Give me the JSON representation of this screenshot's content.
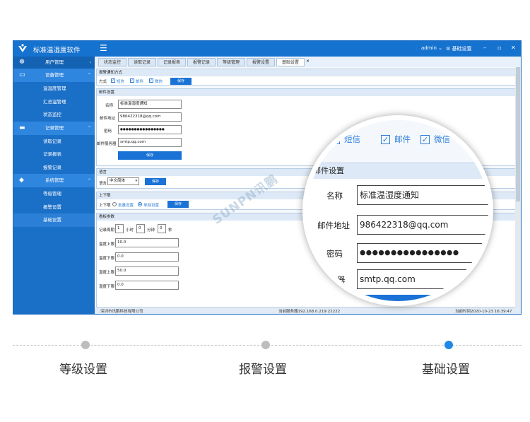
{
  "app": {
    "title": "标准温湿度软件",
    "menu_icon": "☰",
    "user": "admin",
    "settings": "基础设置",
    "win_min": "–",
    "win_max": "▫",
    "win_close": "✕"
  },
  "sidebar": {
    "user_mgmt": "用户管理",
    "groups": [
      {
        "label": "设备管理",
        "icon": "monitor-icon",
        "items": [
          "温湿度管理",
          "汇总温管理",
          "状态监控"
        ]
      },
      {
        "label": "记录管理",
        "icon": "folder-icon",
        "items": [
          "读取记录",
          "记录报表",
          "报警记录"
        ]
      },
      {
        "label": "系统管理",
        "icon": "cube-icon",
        "items": [
          "等级管理",
          "报警设置",
          "基础设置"
        ]
      }
    ]
  },
  "tabs": [
    "状态监控",
    "读取记录",
    "记录报表",
    "报警记录",
    "等级管理",
    "报警设置",
    "基础设置"
  ],
  "alarm_method": {
    "title": "报警通知方式",
    "label": "方式",
    "options": [
      "短信",
      "邮件",
      "微信"
    ],
    "save": "保存"
  },
  "mail": {
    "title": "邮件设置",
    "name_label": "名称",
    "name_value": "标准温湿度通知",
    "address_label": "邮件地址",
    "address_value": "986422318@qq.com",
    "password_label": "密码",
    "password_value": "●●●●●●●●●●●●●●●●",
    "server_label": "邮件服务器",
    "server_value": "smtp.qq.com",
    "save": "保存"
  },
  "language": {
    "title": "语言",
    "label": "语言",
    "value": "中文简体",
    "save": "保存"
  },
  "upload": {
    "title": "上下限",
    "label": "上下限",
    "option1": "批量设置",
    "option2": "单独设置",
    "save": "保存"
  },
  "params": {
    "title": "看板参数",
    "cycle_label": "记录周期",
    "hour_value": "1",
    "hour_unit": "小时",
    "minute_value": "0",
    "minute_unit": "分钟",
    "second_value": "0",
    "second_unit": "秒",
    "rows": [
      {
        "label": "温度上限",
        "value": "10.0"
      },
      {
        "label": "温度下限",
        "value": "0.0"
      },
      {
        "label": "湿度上限",
        "value": "50.0"
      },
      {
        "label": "湿度下限",
        "value": "0.0"
      }
    ]
  },
  "status": {
    "company": "深圳市讯鹏科技有限公司",
    "server": "当前服务器192.168.0.219:22222",
    "time": "当前时间2020-10-23 16:39:47"
  },
  "magnifier": {
    "options": [
      "短信",
      "邮件",
      "微信"
    ],
    "title": "邮件设置",
    "name_label": "名称",
    "name_value": "标准温湿度通知",
    "address_label": "邮件地址",
    "address_value": "986422318@qq.com",
    "password_label": "密码",
    "password_value": "●●●●●●●●●●●●●●●●",
    "server_label": "服务器",
    "server_value": "smtp.qq.com"
  },
  "watermark": "SUNPN讯鹏",
  "bottom_nav": [
    "等级设置",
    "报警设置",
    "基础设置"
  ],
  "colors": {
    "accent": "#1672cf",
    "active_dot": "#1f8ae6",
    "inactive_dot": "#bdbdbd"
  }
}
